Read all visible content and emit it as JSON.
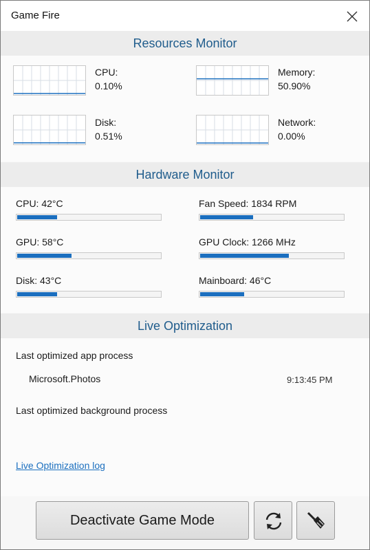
{
  "window": {
    "title": "Game Fire"
  },
  "resources_monitor": {
    "header": "Resources Monitor",
    "items": [
      {
        "label": "CPU:",
        "value": "0.10%",
        "level": 0.001
      },
      {
        "label": "Memory:",
        "value": "50.90%",
        "level": 0.509
      },
      {
        "label": "Disk:",
        "value": "0.51%",
        "level": 0.0051
      },
      {
        "label": "Network:",
        "value": "0.00%",
        "level": 0.0
      }
    ]
  },
  "hardware_monitor": {
    "header": "Hardware Monitor",
    "items": [
      {
        "label": "CPU: 42°C",
        "level": 0.28
      },
      {
        "label": "Fan Speed: 1834 RPM",
        "level": 0.37
      },
      {
        "label": "GPU: 58°C",
        "level": 0.38
      },
      {
        "label": "GPU Clock: 1266 MHz",
        "level": 0.62
      },
      {
        "label": "Disk: 43°C",
        "level": 0.28
      },
      {
        "label": "Mainboard: 46°C",
        "level": 0.31
      }
    ],
    "bar_color": "#1b6fbf"
  },
  "live_optimization": {
    "header": "Live Optimization",
    "app_process_label": "Last optimized app process",
    "app_process_name": "Microsoft.Photos",
    "app_process_time": "9:13:45 PM",
    "background_process_label": "Last optimized background process",
    "log_link": "Live Optimization log"
  },
  "buttons": {
    "deactivate": "Deactivate Game Mode",
    "refresh_icon": "refresh-icon",
    "clean_icon": "broom-icon"
  },
  "colors": {
    "accent": "#1f5c8c",
    "link": "#1b6fbf"
  }
}
